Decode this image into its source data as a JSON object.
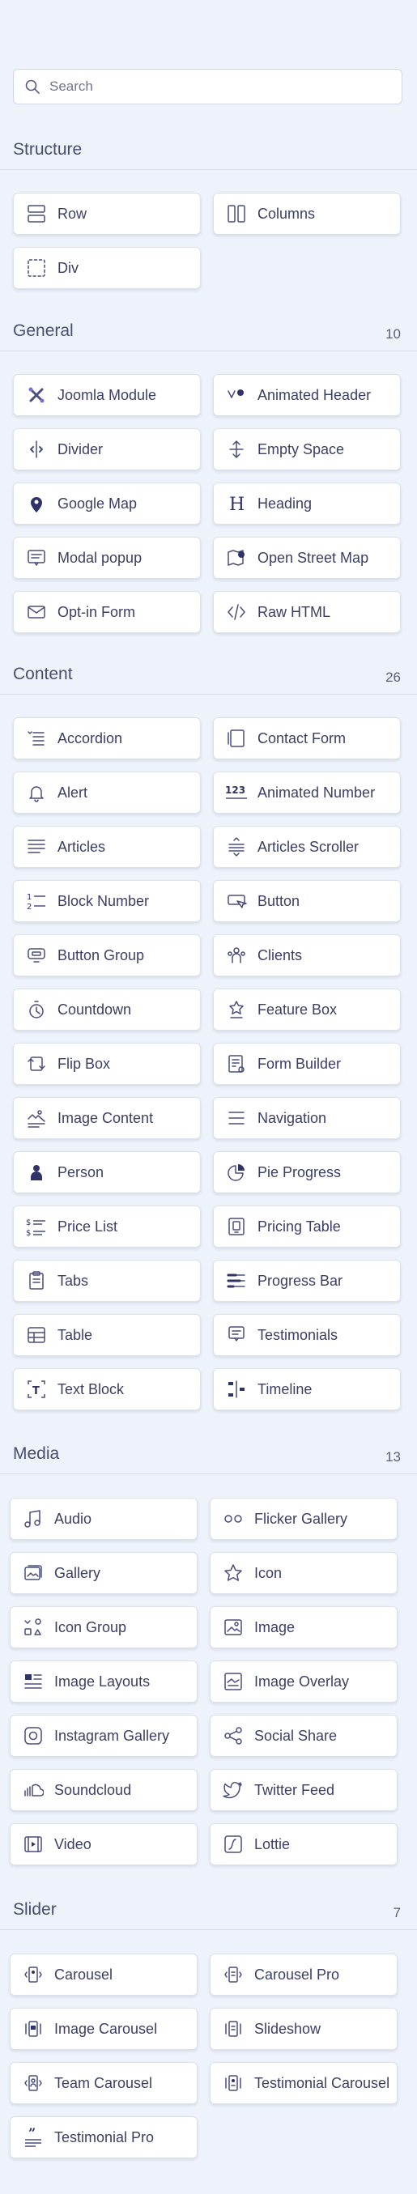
{
  "search": {
    "placeholder": "Search"
  },
  "sections": [
    {
      "title": "Structure",
      "count": "",
      "items": [
        {
          "label": "Row",
          "icon": "row-icon"
        },
        {
          "label": "Columns",
          "icon": "columns-icon"
        },
        {
          "label": "Div",
          "icon": "div-icon"
        }
      ]
    },
    {
      "title": "General",
      "count": "10",
      "items": [
        {
          "label": "Joomla Module",
          "icon": "joomla-icon"
        },
        {
          "label": "Animated Header",
          "icon": "animated-header-icon"
        },
        {
          "label": "Divider",
          "icon": "divider-icon"
        },
        {
          "label": "Empty Space",
          "icon": "empty-space-icon"
        },
        {
          "label": "Google Map",
          "icon": "map-pin-icon"
        },
        {
          "label": "Heading",
          "icon": "heading-icon"
        },
        {
          "label": "Modal popup",
          "icon": "modal-icon"
        },
        {
          "label": "Open Street Map",
          "icon": "street-map-icon"
        },
        {
          "label": "Opt-in Form",
          "icon": "envelope-icon"
        },
        {
          "label": "Raw HTML",
          "icon": "code-icon"
        }
      ]
    },
    {
      "title": "Content",
      "count": "26",
      "items": [
        {
          "label": "Accordion",
          "icon": "accordion-icon"
        },
        {
          "label": "Contact Form",
          "icon": "contact-form-icon"
        },
        {
          "label": "Alert",
          "icon": "bell-icon"
        },
        {
          "label": "Animated Number",
          "icon": "number-icon"
        },
        {
          "label": "Articles",
          "icon": "articles-icon"
        },
        {
          "label": "Articles Scroller",
          "icon": "articles-scroller-icon"
        },
        {
          "label": "Block Number",
          "icon": "block-number-icon"
        },
        {
          "label": "Button",
          "icon": "button-icon"
        },
        {
          "label": "Button Group",
          "icon": "button-group-icon"
        },
        {
          "label": "Clients",
          "icon": "clients-icon"
        },
        {
          "label": "Countdown",
          "icon": "stopwatch-icon"
        },
        {
          "label": "Feature Box",
          "icon": "feature-box-icon"
        },
        {
          "label": "Flip Box",
          "icon": "flip-box-icon"
        },
        {
          "label": "Form Builder",
          "icon": "form-builder-icon"
        },
        {
          "label": "Image Content",
          "icon": "image-content-icon"
        },
        {
          "label": "Navigation",
          "icon": "navigation-icon"
        },
        {
          "label": "Person",
          "icon": "person-icon"
        },
        {
          "label": "Pie Progress",
          "icon": "pie-icon"
        },
        {
          "label": "Price List",
          "icon": "price-list-icon"
        },
        {
          "label": "Pricing Table",
          "icon": "pricing-table-icon"
        },
        {
          "label": "Tabs",
          "icon": "tabs-icon"
        },
        {
          "label": "Progress Bar",
          "icon": "progress-bar-icon"
        },
        {
          "label": "Table",
          "icon": "table-icon"
        },
        {
          "label": "Testimonials",
          "icon": "testimonials-icon"
        },
        {
          "label": "Text Block",
          "icon": "text-block-icon"
        },
        {
          "label": "Timeline",
          "icon": "timeline-icon"
        }
      ]
    },
    {
      "title": "Media",
      "count": "13",
      "items": [
        {
          "label": "Audio",
          "icon": "music-note-icon"
        },
        {
          "label": "Flicker Gallery",
          "icon": "flicker-icon"
        },
        {
          "label": "Gallery",
          "icon": "gallery-icon"
        },
        {
          "label": "Icon",
          "icon": "star-icon"
        },
        {
          "label": "Icon Group",
          "icon": "icon-group-icon"
        },
        {
          "label": "Image",
          "icon": "image-icon"
        },
        {
          "label": "Image Layouts",
          "icon": "image-layouts-icon"
        },
        {
          "label": "Image Overlay",
          "icon": "image-overlay-icon"
        },
        {
          "label": "Instagram Gallery",
          "icon": "instagram-icon"
        },
        {
          "label": "Social Share",
          "icon": "share-icon"
        },
        {
          "label": "Soundcloud",
          "icon": "soundcloud-icon"
        },
        {
          "label": "Twitter Feed",
          "icon": "twitter-icon"
        },
        {
          "label": "Video",
          "icon": "video-icon"
        },
        {
          "label": "Lottie",
          "icon": "lottie-icon"
        }
      ]
    },
    {
      "title": "Slider",
      "count": "7",
      "items": [
        {
          "label": "Carousel",
          "icon": "carousel-icon"
        },
        {
          "label": "Carousel Pro",
          "icon": "carousel-pro-icon"
        },
        {
          "label": "Image Carousel",
          "icon": "image-carousel-icon"
        },
        {
          "label": "Slideshow",
          "icon": "slideshow-icon"
        },
        {
          "label": "Team Carousel",
          "icon": "team-carousel-icon"
        },
        {
          "label": "Testimonial Carousel",
          "icon": "testimonial-carousel-icon"
        },
        {
          "label": "Testimonial Pro",
          "icon": "testimonial-pro-icon"
        }
      ]
    }
  ]
}
